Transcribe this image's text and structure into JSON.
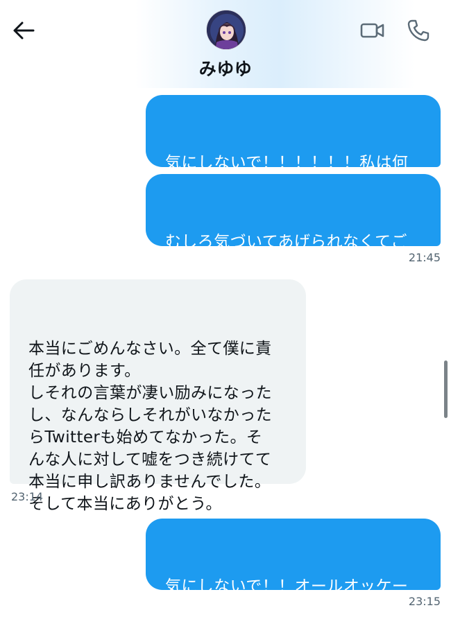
{
  "header": {
    "contact_name": "みゆゆ",
    "avatar_icon": "avatar-icon",
    "back_icon": "back-arrow-icon",
    "video_icon": "video-call-icon",
    "call_icon": "phone-call-icon"
  },
  "colors": {
    "sent_bubble": "#1d9bf0",
    "received_bubble": "#eff3f4",
    "header_tint": "#dbeefc",
    "icon_gray": "#5b6b77"
  },
  "messages": [
    {
      "direction": "sent",
      "text": "気にしないで！！！！！！私は何\nも責めないよ！！！！！！！"
    },
    {
      "direction": "sent",
      "text": "むしろ気づいてあげられなくてご\nめん！！",
      "time": "21:45"
    },
    {
      "direction": "received",
      "text": "本当にごめんなさい。全て僕に責\n任があります。\nしそれの言葉が凄い励みになった\nし、なんならしそれがいなかった\nらTwitterも始めてなかった。そ\nんな人に対して嘘をつき続けてて\n本当に申し訳ありませんでした。\nそして本当にありがとう。",
      "time": "23:14"
    },
    {
      "direction": "sent",
      "text": "気にしないで！！オールオッケー\nだよ！",
      "time": "23:15"
    }
  ]
}
